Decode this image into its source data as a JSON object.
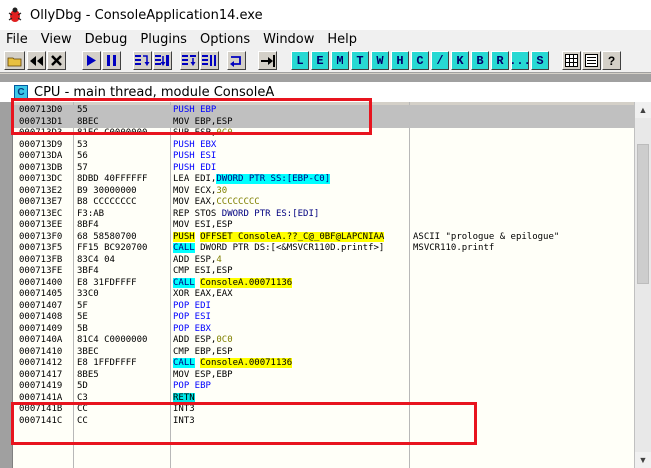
{
  "window": {
    "title": "OllyDbg - ConsoleApplication14.exe"
  },
  "menu": [
    "File",
    "View",
    "Debug",
    "Plugins",
    "Options",
    "Window",
    "Help"
  ],
  "toolbar": {
    "letters": [
      "L",
      "E",
      "M",
      "T",
      "W",
      "H",
      "C",
      "/",
      "K",
      "B",
      "R",
      "...",
      "S"
    ],
    "letter_color": "#27d9d3"
  },
  "cpu_window": {
    "title": "CPU - main thread, module ConsoleA",
    "icon_letter": "C"
  },
  "disasm": [
    {
      "addr": "000713D0",
      "hex": "55",
      "parts": [
        {
          "t": "PUSH EBP",
          "c": "kw-blue"
        }
      ],
      "comment": ""
    },
    {
      "addr": "000713D1",
      "hex": "8BEC",
      "parts": [
        {
          "t": "MOV EBP,ESP",
          "c": ""
        }
      ],
      "comment": ""
    },
    {
      "addr": "000713D3",
      "hex": "81EC C0000000",
      "parts": [
        {
          "t": "SUB ESP,",
          "c": ""
        },
        {
          "t": "0C0",
          "c": "olive"
        }
      ],
      "comment": ""
    },
    {
      "addr": "000713D9",
      "hex": "53",
      "parts": [
        {
          "t": "PUSH EBX",
          "c": "kw-blue"
        }
      ],
      "comment": ""
    },
    {
      "addr": "000713DA",
      "hex": "56",
      "parts": [
        {
          "t": "PUSH ESI",
          "c": "kw-blue"
        }
      ],
      "comment": ""
    },
    {
      "addr": "000713DB",
      "hex": "57",
      "parts": [
        {
          "t": "PUSH EDI",
          "c": "kw-blue"
        }
      ],
      "comment": ""
    },
    {
      "addr": "000713DC",
      "hex": "8DBD 40FFFFFF",
      "parts": [
        {
          "t": "LEA EDI,",
          "c": ""
        },
        {
          "t": "DWORD PTR SS:[EBP-C0]",
          "c": "hl-cyan"
        }
      ],
      "comment": ""
    },
    {
      "addr": "000713E2",
      "hex": "B9 30000000",
      "parts": [
        {
          "t": "MOV ECX,",
          "c": ""
        },
        {
          "t": "30",
          "c": "olive"
        }
      ],
      "comment": ""
    },
    {
      "addr": "000713E7",
      "hex": "B8 CCCCCCCC",
      "parts": [
        {
          "t": "MOV EAX,",
          "c": ""
        },
        {
          "t": "CCCCCCCC",
          "c": "olive"
        }
      ],
      "comment": ""
    },
    {
      "addr": "000713EC",
      "hex": "F3:AB",
      "parts": [
        {
          "t": "REP STOS ",
          "c": ""
        },
        {
          "t": "DWORD PTR ES:[EDI]",
          "c": "kw-navy"
        }
      ],
      "comment": ""
    },
    {
      "addr": "000713EE",
      "hex": "8BF4",
      "parts": [
        {
          "t": "MOV ESI,ESP",
          "c": ""
        }
      ],
      "comment": ""
    },
    {
      "addr": "000713F0",
      "hex": "68 58580700",
      "parts": [
        {
          "t": "PUSH",
          "c": "hl-yellow"
        },
        {
          "t": " ",
          "c": ""
        },
        {
          "t": "OFFSET ConsoleA.??_C@_0BF@LAPCNIAA",
          "c": "hl-yellow"
        }
      ],
      "comment": "ASCII \"prologue & epilogue\""
    },
    {
      "addr": "000713F5",
      "hex": "FF15 BC920700",
      "parts": [
        {
          "t": "CALL",
          "c": "hl-cyan"
        },
        {
          "t": " DWORD PTR DS:[<&MSVCR110D.printf>]",
          "c": ""
        }
      ],
      "comment": "MSVCR110.printf"
    },
    {
      "addr": "000713FB",
      "hex": "83C4 04",
      "parts": [
        {
          "t": "ADD ESP,",
          "c": ""
        },
        {
          "t": "4",
          "c": "olive"
        }
      ],
      "comment": ""
    },
    {
      "addr": "000713FE",
      "hex": "3BF4",
      "parts": [
        {
          "t": "CMP ESI,ESP",
          "c": ""
        }
      ],
      "comment": ""
    },
    {
      "addr": "00071400",
      "hex": "E8 31FDFFFF",
      "parts": [
        {
          "t": "CALL",
          "c": "hl-cyan"
        },
        {
          "t": " ",
          "c": ""
        },
        {
          "t": "ConsoleA.00071136",
          "c": "hl-yellow"
        }
      ],
      "comment": ""
    },
    {
      "addr": "00071405",
      "hex": "33C0",
      "parts": [
        {
          "t": "XOR EAX,EAX",
          "c": ""
        }
      ],
      "comment": ""
    },
    {
      "addr": "00071407",
      "hex": "5F",
      "parts": [
        {
          "t": "POP EDI",
          "c": "kw-blue"
        }
      ],
      "comment": ""
    },
    {
      "addr": "00071408",
      "hex": "5E",
      "parts": [
        {
          "t": "POP ESI",
          "c": "kw-blue"
        }
      ],
      "comment": ""
    },
    {
      "addr": "00071409",
      "hex": "5B",
      "parts": [
        {
          "t": "POP EBX",
          "c": "kw-blue"
        }
      ],
      "comment": ""
    },
    {
      "addr": "0007140A",
      "hex": "81C4 C0000000",
      "parts": [
        {
          "t": "ADD ESP,",
          "c": ""
        },
        {
          "t": "0C0",
          "c": "olive"
        }
      ],
      "comment": ""
    },
    {
      "addr": "00071410",
      "hex": "3BEC",
      "parts": [
        {
          "t": "CMP EBP,ESP",
          "c": ""
        }
      ],
      "comment": ""
    },
    {
      "addr": "00071412",
      "hex": "E8 1FFDFFFF",
      "parts": [
        {
          "t": "CALL",
          "c": "hl-cyan"
        },
        {
          "t": " ",
          "c": ""
        },
        {
          "t": "ConsoleA.00071136",
          "c": "hl-yellow"
        }
      ],
      "comment": ""
    },
    {
      "addr": "00071417",
      "hex": "8BE5",
      "parts": [
        {
          "t": "MOV ESP,EBP",
          "c": ""
        }
      ],
      "comment": ""
    },
    {
      "addr": "00071419",
      "hex": "5D",
      "parts": [
        {
          "t": "POP EBP",
          "c": "kw-blue"
        }
      ],
      "comment": ""
    },
    {
      "addr": "0007141A",
      "hex": "C3",
      "parts": [
        {
          "t": "RETN",
          "c": "hl-cyan2"
        }
      ],
      "comment": ""
    },
    {
      "addr": "0007141B",
      "hex": "CC",
      "parts": [
        {
          "t": "INT3",
          "c": ""
        }
      ],
      "comment": ""
    },
    {
      "addr": "0007141C",
      "hex": "CC",
      "parts": [
        {
          "t": "INT3",
          "c": ""
        }
      ],
      "comment": ""
    }
  ],
  "selected_rows": [
    0,
    1
  ],
  "highlight_color": "#e8141e"
}
